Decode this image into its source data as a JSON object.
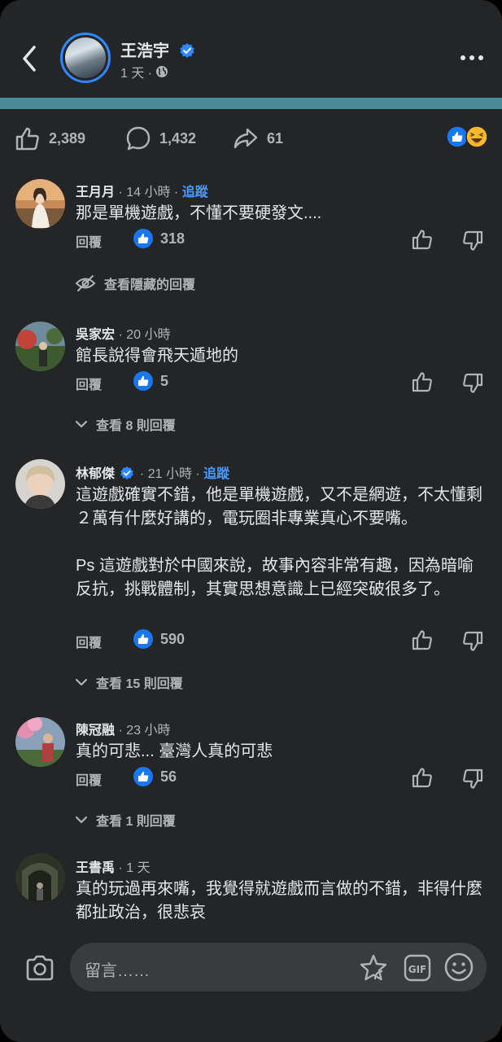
{
  "header": {
    "author_name": "王浩宇",
    "post_time": "1 天 ·"
  },
  "stats": {
    "likes": "2,389",
    "comments": "1,432",
    "shares": "61"
  },
  "comments": [
    {
      "name": "王月月",
      "time": "· 14 小時 ·",
      "follow": "追蹤",
      "text": "那是單機遊戲，不懂不要硬發文....",
      "reply_label": "回覆",
      "likes": "318",
      "extra_link": "查看隱藏的回覆"
    },
    {
      "name": "吳家宏",
      "time": "· 20 小時",
      "text": "館長說得會飛天遁地的",
      "reply_label": "回覆",
      "likes": "5",
      "extra_link": "查看 8 則回覆"
    },
    {
      "name": "林郁傑",
      "time": "· 21 小時 ·",
      "follow": "追蹤",
      "text": "這遊戲確實不錯，他是單機遊戲，又不是網遊，不太懂剩２萬有什麼好講的，電玩圈非專業真心不要嘴。\n\nPs 這遊戲對於中國來說，故事內容非常有趣，因為暗喻反抗，挑戰體制，其實思想意識上已經突破很多了。",
      "reply_label": "回覆",
      "likes": "590",
      "extra_link": "查看 15 則回覆"
    },
    {
      "name": "陳冠融",
      "time": "· 23 小時",
      "text": "真的可悲... 臺灣人真的可悲",
      "reply_label": "回覆",
      "likes": "56",
      "extra_link": "查看 1 則回覆"
    },
    {
      "name": "王書禹",
      "time": "· 1 天",
      "text": "真的玩過再來嘴，我覺得就遊戲而言做的不錯，非得什麼都扯政治，很悲哀"
    }
  ],
  "composer": {
    "placeholder": "留言……",
    "gif_label": "GIF"
  },
  "colors": {
    "background": "#242526",
    "accent_blue": "#2d88ff",
    "link_blue": "#4599ff",
    "secondary_text": "#b0b3b8",
    "primary_text": "#e4e6eb",
    "strip_teal": "#4a8a96"
  },
  "icons": [
    "back-chevron-icon",
    "verified-badge-icon",
    "globe-icon",
    "more-dots-icon",
    "like-icon",
    "comment-icon",
    "share-icon",
    "like-reaction-icon",
    "haha-reaction-icon",
    "like-badge-icon",
    "thumbs-up-icon",
    "thumbs-down-icon",
    "hidden-eye-icon",
    "chevron-down-icon",
    "camera-icon",
    "sticker-icon",
    "gif-icon",
    "emoji-icon"
  ]
}
